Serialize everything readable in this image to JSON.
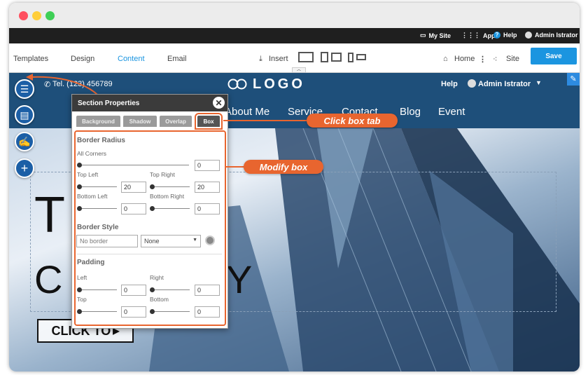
{
  "window": {
    "dot_colors": [
      "#ff4f5f",
      "#ffce3a",
      "#3fcf56"
    ]
  },
  "admin_bar": {
    "my_site": "My Site",
    "apps": "Apps",
    "help": "Help",
    "user": "Admin Istrator"
  },
  "editor_bar": {
    "tabs": [
      "Templates",
      "Design",
      "Content",
      "Email"
    ],
    "active_tab": "Content",
    "insert": "Insert",
    "home": "Home",
    "site": "Site",
    "save": "Save"
  },
  "site_header": {
    "phone": "Tel. (123) 456789",
    "logo": "LOGO",
    "help": "Help",
    "user": "Admin Istrator"
  },
  "nav": {
    "items": [
      "About Me",
      "Service",
      "Contact",
      "Blog",
      "Event"
    ]
  },
  "hero": {
    "big_letter_1": "T",
    "big_word_2": "C",
    "big_word_2_end": "Y",
    "cta": "CLICK TO"
  },
  "panel": {
    "title": "Section Properties",
    "tabs": [
      "Background",
      "Shadow",
      "Overlap",
      "Box"
    ],
    "active_tab": "Box",
    "border_radius": {
      "title": "Border Radius",
      "all_corners_label": "All Corners",
      "all_corners": "0",
      "top_left_label": "Top Left",
      "top_left": "20",
      "top_right_label": "Top Right",
      "top_right": "20",
      "bottom_left_label": "Bottom Left",
      "bottom_left": "0",
      "bottom_right_label": "Bottom Right",
      "bottom_right": "0"
    },
    "border_style": {
      "title": "Border Style",
      "border_placeholder": "No border",
      "style_select": "None"
    },
    "padding": {
      "title": "Padding",
      "left_label": "Left",
      "left": "0",
      "right_label": "Right",
      "right": "0",
      "top_label": "Top",
      "top": "0",
      "bottom_label": "Bottom",
      "bottom": "0"
    }
  },
  "callouts": {
    "click_box_tab": "Click box tab",
    "modify_box": "Modify box"
  },
  "colors": {
    "accent": "#e8652f",
    "nav_blue": "#1e4f7a",
    "save_blue": "#1b95e0"
  }
}
